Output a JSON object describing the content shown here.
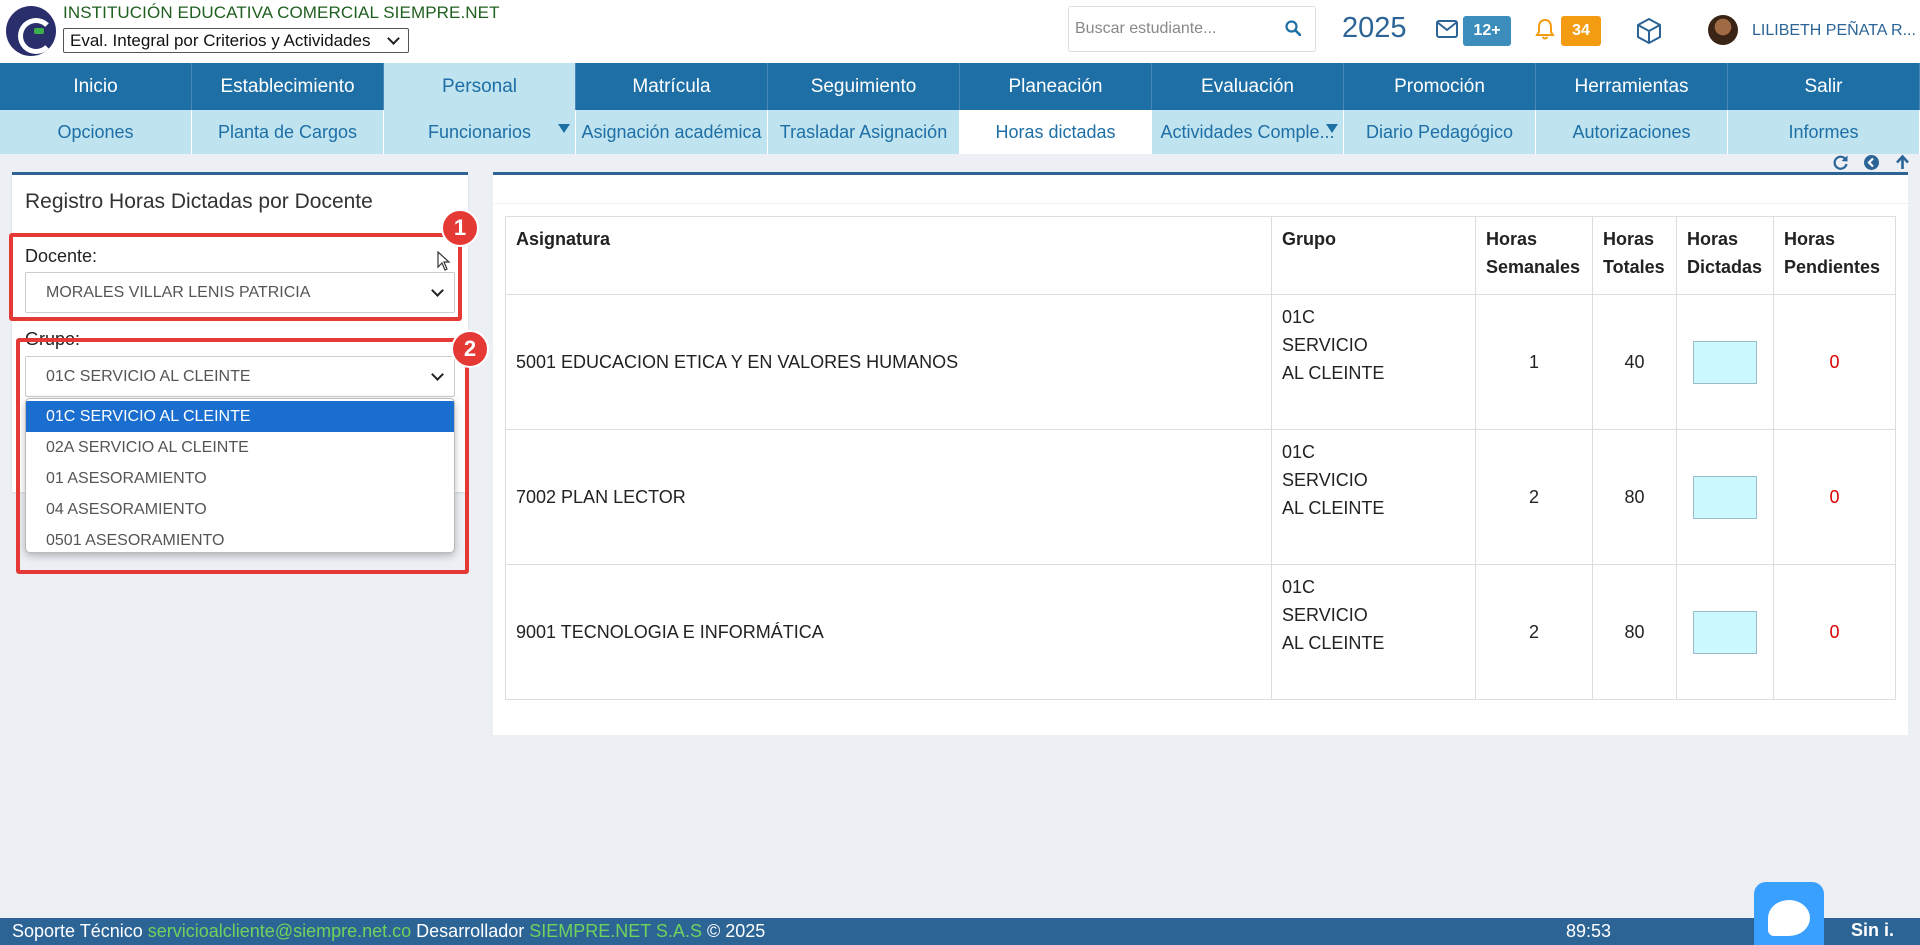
{
  "header": {
    "institution": "INSTITUCIÓN EDUCATIVA COMERCIAL SIEMPRE.NET",
    "eval_selected": "Eval. Integral por Criterios y Actividades",
    "search_placeholder": "Buscar estudiante...",
    "year": "2025",
    "mail_count": "12+",
    "notification_count": "34",
    "user_name": "LILIBETH PEÑATA R..."
  },
  "colors": {
    "primary": "#1e6fa6",
    "nav_light": "#bfe3ef",
    "mail_badge": "#3c8dbc",
    "bell_badge": "#f39c12",
    "pending": "#dd0000",
    "highlight": "#e53935"
  },
  "nav_main": [
    {
      "label": "Inicio"
    },
    {
      "label": "Establecimiento"
    },
    {
      "label": "Personal"
    },
    {
      "label": "Matrícula"
    },
    {
      "label": "Seguimiento"
    },
    {
      "label": "Planeación"
    },
    {
      "label": "Evaluación"
    },
    {
      "label": "Promoción"
    },
    {
      "label": "Herramientas"
    },
    {
      "label": "Salir"
    }
  ],
  "nav_sub": [
    {
      "label": "Opciones"
    },
    {
      "label": "Planta de Cargos"
    },
    {
      "label": "Funcionarios"
    },
    {
      "label": "Asignación académica"
    },
    {
      "label": "Trasladar Asignación"
    },
    {
      "label": "Horas dictadas"
    },
    {
      "label": "Actividades Comple..."
    },
    {
      "label": "Diario Pedagógico"
    },
    {
      "label": "Autorizaciones"
    },
    {
      "label": "Informes"
    }
  ],
  "form": {
    "title": "Registro Horas Dictadas por Docente",
    "docente_label": "Docente:",
    "docente_value": "MORALES VILLAR LENIS PATRICIA",
    "grupo_label": "Grupo:",
    "grupo_value": "01C SERVICIO AL CLEINTE",
    "grupo_options": [
      "01C SERVICIO AL CLEINTE",
      "02A SERVICIO AL CLEINTE",
      "01 ASESORAMIENTO",
      "04 ASESORAMIENTO",
      "0501 ASESORAMIENTO"
    ],
    "marker_1": "1",
    "marker_2": "2"
  },
  "table": {
    "headers": {
      "asignatura": "Asignatura",
      "grupo": "Grupo",
      "semanales_1": "Horas",
      "semanales_2": "Semanales",
      "totales_1": "Horas",
      "totales_2": "Totales",
      "dictadas_1": "Horas",
      "dictadas_2": "Dictadas",
      "pendientes_1": "Horas",
      "pendientes_2": "Pendientes"
    },
    "rows": [
      {
        "asignatura": "5001 EDUCACION ETICA Y EN VALORES HUMANOS",
        "grupo": "01C SERVICIO AL CLEINTE",
        "semanales": "1",
        "totales": "40",
        "pendientes": "0"
      },
      {
        "asignatura": "7002 PLAN LECTOR",
        "grupo": "01C SERVICIO AL CLEINTE",
        "semanales": "2",
        "totales": "80",
        "pendientes": "0"
      },
      {
        "asignatura": "9001 TECNOLOGIA E INFORMÁTICA",
        "grupo": "01C SERVICIO AL CLEINTE",
        "semanales": "2",
        "totales": "80",
        "pendientes": "0"
      }
    ]
  },
  "footer": {
    "support_label": "Soporte Técnico",
    "support_email": "servicioalcliente@siempre.net.co",
    "developer_label": "Desarrollador",
    "developer_name": "SIEMPRE.NET S.A.S",
    "copyright": "© 2025",
    "timer": "89:53",
    "brand": "Sin i."
  }
}
